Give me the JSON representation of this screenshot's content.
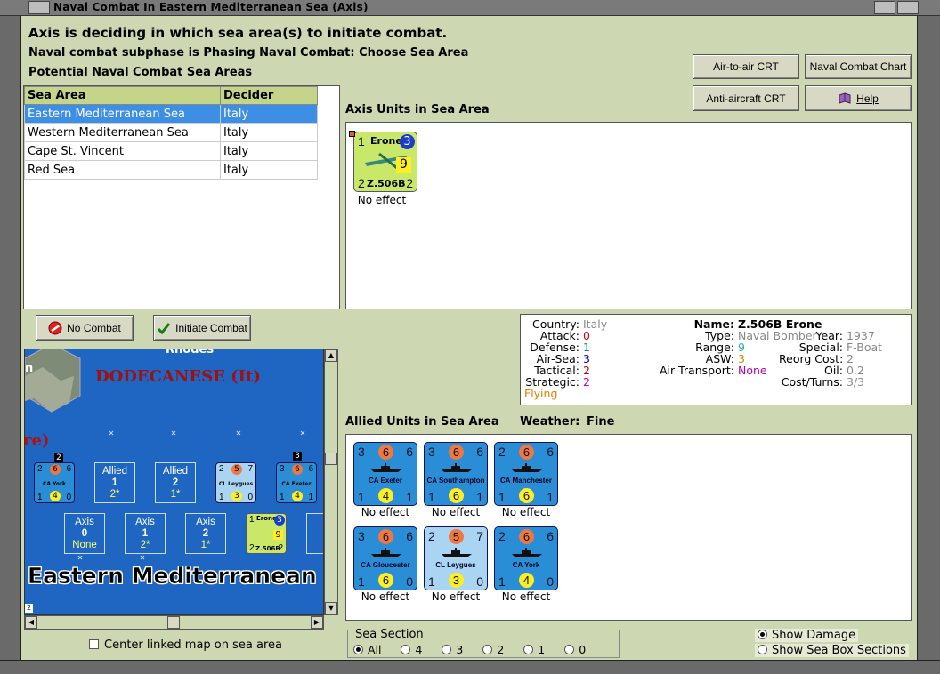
{
  "window": {
    "title": "Naval Combat In Eastern Mediterranean Sea (Axis)"
  },
  "header": {
    "line1": "Axis is deciding in which sea area(s) to initiate combat.",
    "line2": "Naval combat subphase is Phasing Naval Combat: Choose Sea Area",
    "line3": "Potential Naval Combat Sea Areas"
  },
  "buttons": {
    "air_to_air": "Air-to-air CRT",
    "naval_chart": "Naval Combat Chart",
    "anti_aircraft": "Anti-aircraft CRT",
    "help": "Help",
    "no_combat": "No Combat",
    "initiate_combat": "Initiate Combat"
  },
  "sea_table": {
    "columns": [
      "Sea Area",
      "Decider"
    ],
    "rows": [
      {
        "area": "Eastern Mediterranean Sea",
        "decider": "Italy"
      },
      {
        "area": "Western Mediterranean Sea",
        "decider": "Italy"
      },
      {
        "area": "Cape St. Vincent",
        "decider": "Italy"
      },
      {
        "area": "Red Sea",
        "decider": "Italy"
      }
    ]
  },
  "axis_units": {
    "title": "Axis Units in Sea Area",
    "units": [
      {
        "tl": "1",
        "name_top": "Erone",
        "tr": "3",
        "mid": "9",
        "bl": "2",
        "name": "Z.506B",
        "br": "2",
        "effect": "No effect"
      }
    ]
  },
  "unit_info": {
    "country_label": "Country:",
    "country": "Italy",
    "attack_label": "Attack:",
    "attack": "0",
    "defense_label": "Defense:",
    "defense": "1",
    "airsea_label": "Air-Sea:",
    "airsea": "3",
    "tactical_label": "Tactical:",
    "tactical": "2",
    "strategic_label": "Strategic:",
    "strategic": "2",
    "flying": "Flying",
    "name_label": "Name:",
    "name": "Z.506B Erone",
    "type_label": "Type:",
    "type": "Naval Bomber",
    "year_label": "Year:",
    "year": "1937",
    "range_label": "Range:",
    "range": "9",
    "special_label": "Special:",
    "special": "F-Boat",
    "asw_label": "ASW:",
    "asw": "3",
    "reorg_label": "Reorg Cost:",
    "reorg": "2",
    "airtransport_label": "Air Transport:",
    "airtransport": "None",
    "oil_label": "Oil:",
    "oil": "0.2",
    "costturns_label": "Cost/Turns:",
    "costturns": "3/3"
  },
  "allied_units": {
    "title": "Allied Units in Sea Area",
    "weather_label": "Weather:",
    "weather": "Fine",
    "units": [
      {
        "tl": "3",
        "top": "6",
        "tr": "6",
        "name": "CA Exeter",
        "bl": "1",
        "bot": "4",
        "br": "1",
        "light": false,
        "effect": "No effect"
      },
      {
        "tl": "3",
        "top": "6",
        "tr": "6",
        "name": "CA Southampton",
        "bl": "1",
        "bot": "6",
        "br": "1",
        "light": false,
        "effect": "No effect"
      },
      {
        "tl": "2",
        "top": "6",
        "tr": "6",
        "name": "CA Manchester",
        "bl": "1",
        "bot": "6",
        "br": "1",
        "light": false,
        "effect": "No effect"
      },
      {
        "tl": "3",
        "top": "6",
        "tr": "6",
        "name": "CA Gloucester",
        "bl": "1",
        "bot": "6",
        "br": "0",
        "light": false,
        "effect": "No effect"
      },
      {
        "tl": "2",
        "top": "5",
        "tr": "7",
        "name": "CL Leygues",
        "bl": "1",
        "bot": "3",
        "br": "0",
        "light": true,
        "effect": "No effect"
      },
      {
        "tl": "2",
        "top": "6",
        "tr": "6",
        "name": "CA York",
        "bl": "1",
        "bot": "4",
        "br": "0",
        "light": false,
        "effect": "No effect"
      }
    ]
  },
  "map": {
    "rhodes": "Rhodes",
    "dodecanese": "DODECANESE (It)",
    "re": "re)",
    "n": "n",
    "sea_label": "Eastern Mediterranean",
    "allied_boxes": [
      {
        "label": "Allied",
        "num": "1",
        "val": "2*"
      },
      {
        "label": "Allied",
        "num": "2",
        "val": "1*"
      }
    ],
    "axis_boxes": [
      {
        "label": "Axis",
        "num": "0",
        "val": "None"
      },
      {
        "label": "Axis",
        "num": "1",
        "val": "2*"
      },
      {
        "label": "Axis",
        "num": "2",
        "val": "1*"
      },
      {
        "label": "A"
      }
    ],
    "york": {
      "stack": "2",
      "a": "2",
      "o": "6",
      "b": "6",
      "n": "CA York",
      "c": "1",
      "y": "4",
      "d": "0"
    },
    "leygues": {
      "a": "2",
      "o": "5",
      "b": "7",
      "n": "CL Leygues",
      "c": "1",
      "y": "3",
      "d": "0"
    },
    "exeter": {
      "stack": "3",
      "a": "3",
      "o": "6",
      "b": "6",
      "n": "CA Exeter",
      "c": "1",
      "y": "4",
      "d": "1"
    },
    "erone": {
      "a": "1",
      "top": "Erone",
      "b": "3",
      "mid": "9",
      "c": "2",
      "n": "Z.506B",
      "d": "2"
    },
    "corner": "2"
  },
  "center_map_label": "Center linked map on sea area",
  "sea_section": {
    "title": "Sea Section",
    "options": [
      "All",
      "4",
      "3",
      "2",
      "1",
      "0"
    ],
    "selected": "All"
  },
  "show_damage": "Show Damage",
  "show_sea_box": "Show Sea Box Sections"
}
